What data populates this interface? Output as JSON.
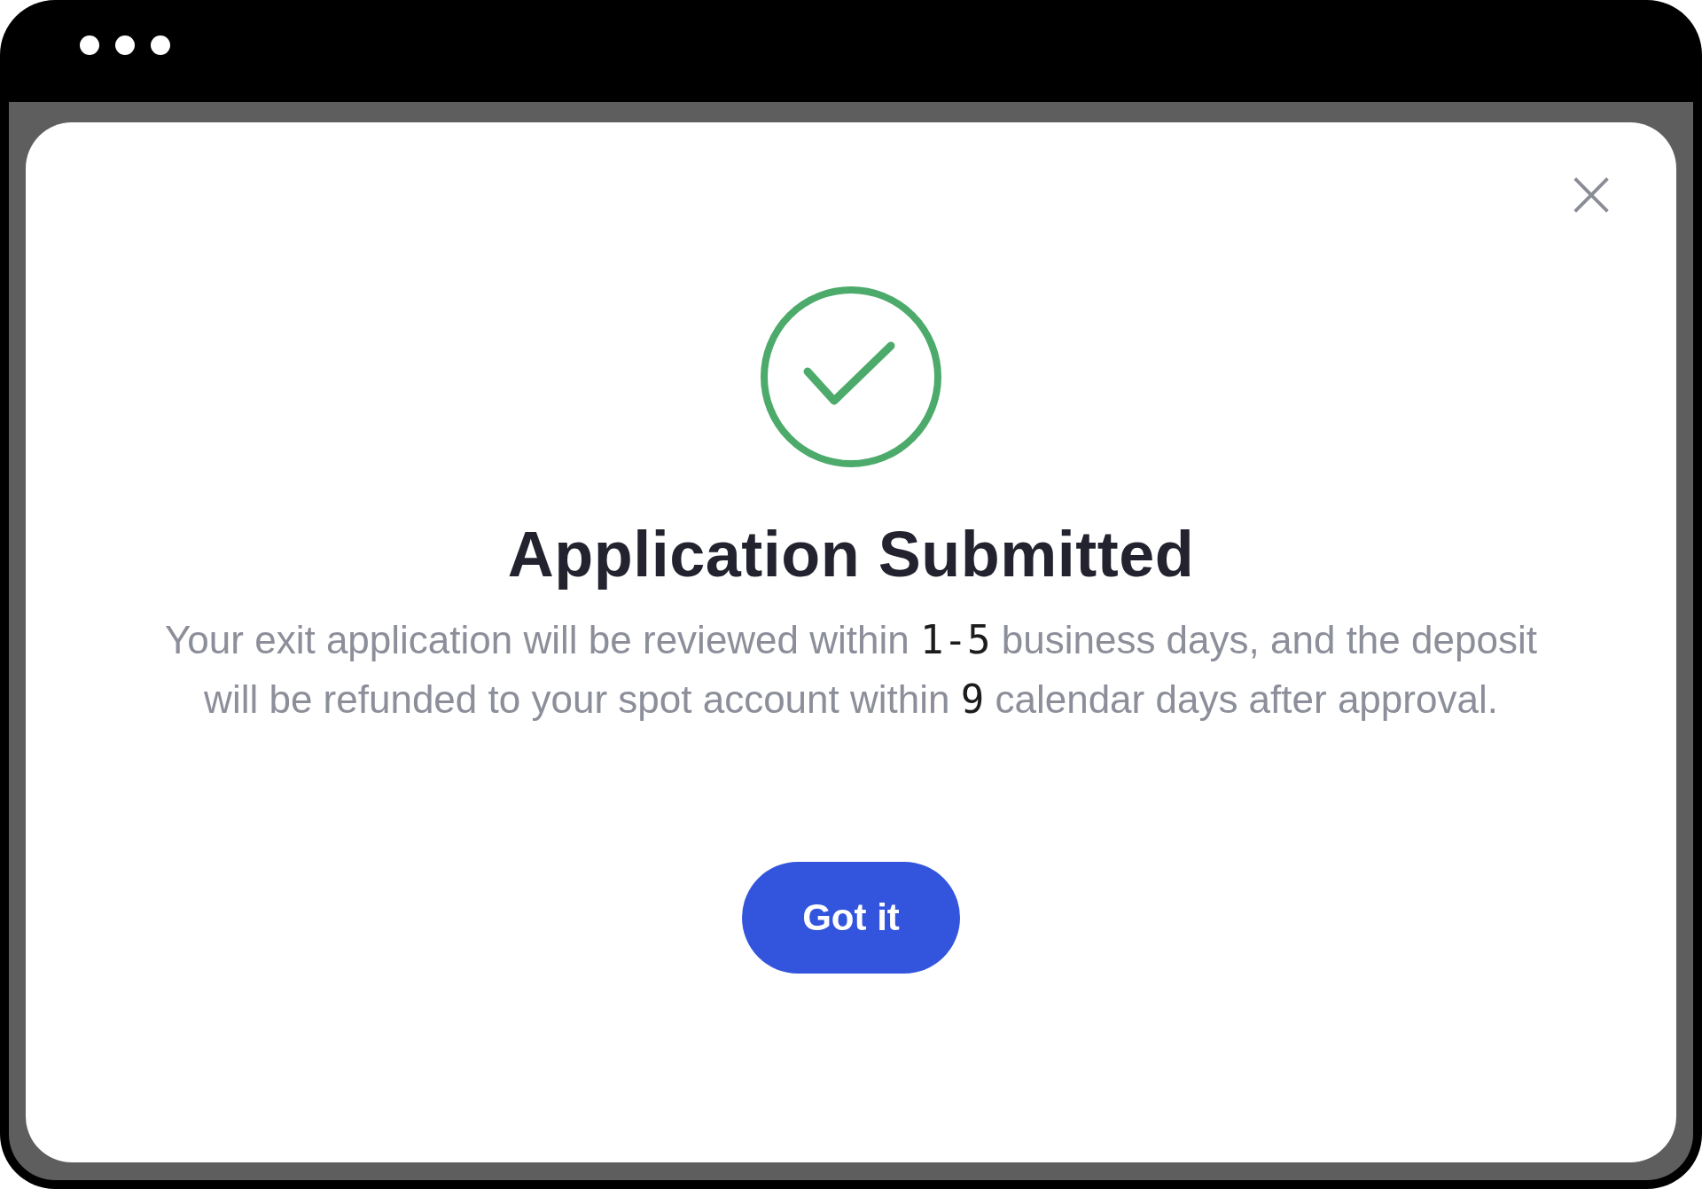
{
  "dialog": {
    "close": "×",
    "title": "Application Submitted",
    "message": [
      {
        "kind": "plain",
        "text": "Your exit application will be reviewed within "
      },
      {
        "kind": "number",
        "text": "1-5"
      },
      {
        "kind": "plain",
        "text": " business days, and the deposit will be refunded to your spot account within "
      },
      {
        "kind": "number",
        "text": "9"
      },
      {
        "kind": "plain",
        "text": " calendar days after approval."
      }
    ],
    "button": "Got it"
  }
}
